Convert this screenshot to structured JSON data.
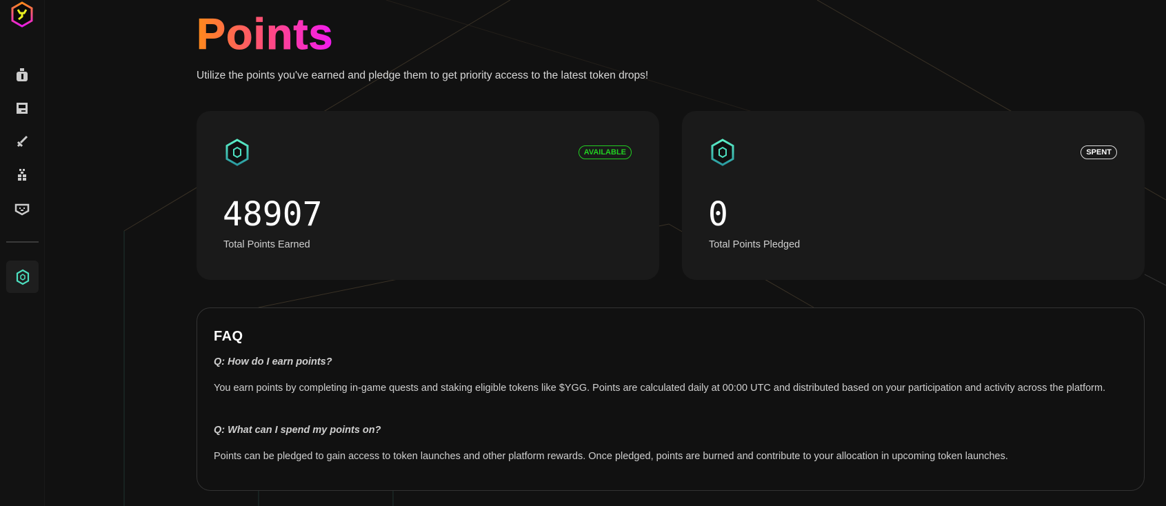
{
  "page": {
    "title": "Points",
    "subtitle": "Utilize the points you've earned and pledge them to get priority access to the latest token drops!"
  },
  "sidebar": {
    "items": [
      {
        "name": "potion-icon"
      },
      {
        "name": "save-icon"
      },
      {
        "name": "sword-icon"
      },
      {
        "name": "gift-icon"
      },
      {
        "name": "badge-icon"
      },
      {
        "name": "points-icon",
        "active": true
      }
    ]
  },
  "cards": [
    {
      "badge": "AVAILABLE",
      "badge_color": "#22d022",
      "value": "48907",
      "label": "Total Points Earned"
    },
    {
      "badge": "SPENT",
      "badge_color": "#ffffff",
      "value": "0",
      "label": "Total Points Pledged"
    }
  ],
  "faq": {
    "heading": "FAQ",
    "items": [
      {
        "q": "Q: How do I earn points?",
        "a": "You earn points by completing in-game quests and staking eligible tokens like $YGG. Points are calculated daily at 00:00 UTC and distributed based on your participation and activity across the platform."
      },
      {
        "q": "Q: What can I spend my points on?",
        "a": "Points can be pledged to gain access to token launches and other platform rewards. Once pledged, points are burned and contribute to your allocation in upcoming token launches."
      }
    ]
  },
  "colors": {
    "accent_teal": "#4de0c0",
    "title_start": "#ff8a1a",
    "title_end": "#f21af2"
  }
}
